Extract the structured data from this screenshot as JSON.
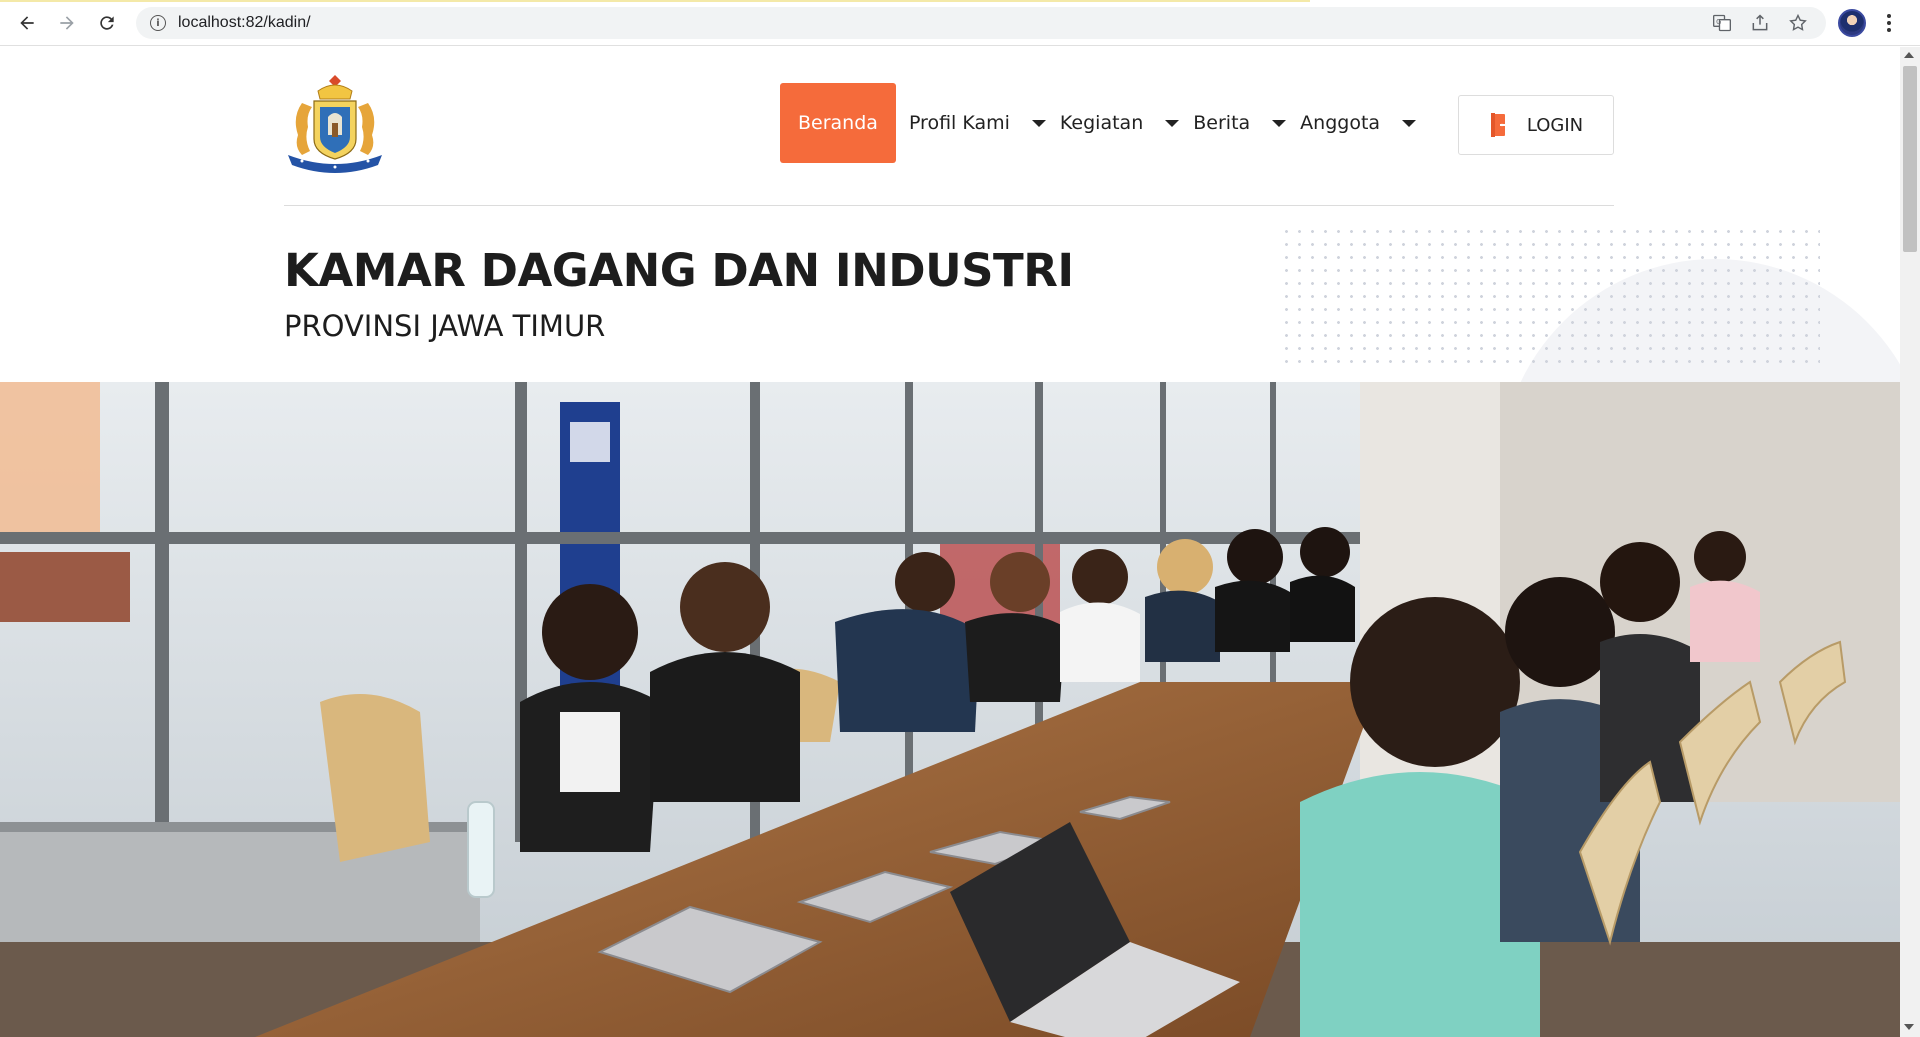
{
  "browser": {
    "url": "localhost:82/kadin/",
    "icons": [
      "back-arrow-icon",
      "forward-arrow-icon",
      "reload-icon",
      "info-icon",
      "translate-icon",
      "share-icon",
      "star-icon",
      "profile-avatar",
      "kebab-menu-icon"
    ]
  },
  "nav": {
    "items": [
      {
        "label": "Beranda",
        "active": true,
        "dropdown": false
      },
      {
        "label": "Profil Kami",
        "active": false,
        "dropdown": true
      },
      {
        "label": "Kegiatan",
        "active": false,
        "dropdown": true
      },
      {
        "label": "Berita",
        "active": false,
        "dropdown": true
      },
      {
        "label": "Anggota",
        "active": false,
        "dropdown": true
      }
    ],
    "login_label": "LOGIN"
  },
  "hero": {
    "title": "KAMAR DAGANG DAN INDUSTRI",
    "subtitle": "PROVINSI JAWA TIMUR"
  },
  "colors": {
    "accent": "#f56b3b",
    "text": "#1d1d1d"
  }
}
